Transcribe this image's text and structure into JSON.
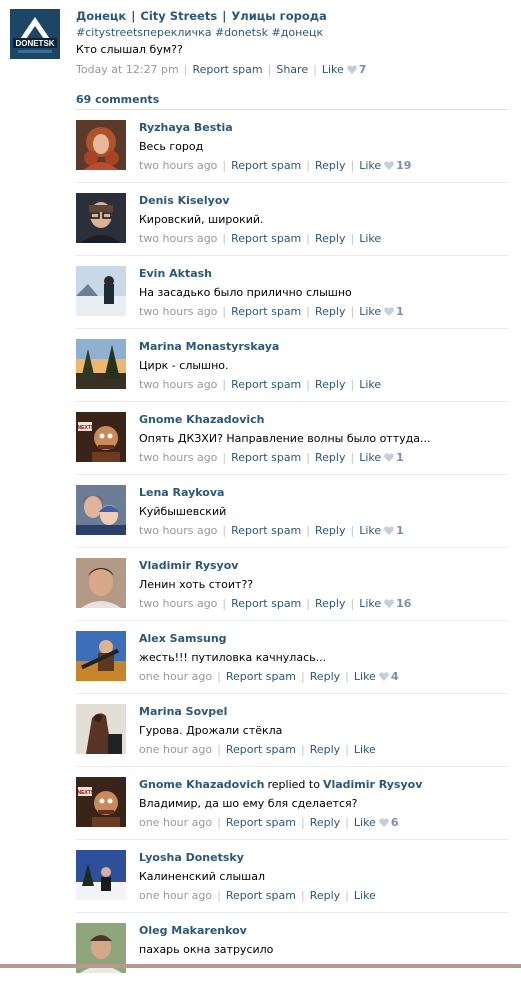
{
  "post": {
    "group_logo_text": "DONETSK",
    "header_parts": [
      "Донецк",
      "City Streets",
      "Улицы города"
    ],
    "tags": "#citystreetsперекличка #donetsk #донецк",
    "text": "Кто слышал бум??",
    "time": "Today at 12:27 pm",
    "report_label": "Report spam",
    "share_label": "Share",
    "like_label": "Like",
    "like_count": "7"
  },
  "comments_header": "69 comments",
  "comments": [
    {
      "author": "Ryzhaya Bestia",
      "reply_to": "",
      "text": "Весь город",
      "time": "two hours ago",
      "likes": "19",
      "avatar": "woman-red-hair"
    },
    {
      "author": "Denis Kiselyov",
      "reply_to": "",
      "text": "Кировский, широкий.",
      "time": "two hours ago",
      "likes": "",
      "avatar": "man-glasses"
    },
    {
      "author": "Evin Aktash",
      "reply_to": "",
      "text": "На засадько было прилично слышно",
      "time": "two hours ago",
      "likes": "1",
      "avatar": "winter-scene"
    },
    {
      "author": "Marina Monastyrskaya",
      "reply_to": "",
      "text": "Цирк - слышно.",
      "time": "two hours ago",
      "likes": "",
      "avatar": "sunset-trees"
    },
    {
      "author": "Gnome Khazadovich",
      "reply_to": "",
      "text": "Опять ДКЗХИ? Направление волны было оттуда...",
      "time": "two hours ago",
      "likes": "1",
      "avatar": "cartoon-next"
    },
    {
      "author": "Lena Raykova",
      "reply_to": "",
      "text": "Куйбышевский",
      "time": "two hours ago",
      "likes": "1",
      "avatar": "mother-child"
    },
    {
      "author": "Vladimir Rysyov",
      "reply_to": "",
      "text": "Ленин хоть стоит??",
      "time": "two hours ago",
      "likes": "16",
      "avatar": "man-portrait"
    },
    {
      "author": "Alex Samsung",
      "reply_to": "",
      "text": "жесть!!! путиловка качнулась...",
      "time": "one hour ago",
      "likes": "4",
      "avatar": "game-character"
    },
    {
      "author": "Marina Sovpel",
      "reply_to": "",
      "text": "Гурова. Дрожали стёкла",
      "time": "one hour ago",
      "likes": "",
      "avatar": "horse-photo"
    },
    {
      "author": "Gnome Khazadovich",
      "replied_label": "replied to",
      "reply_to": "Vladimir Rysyov",
      "text": "Владимир, да шо ему бля сделается?",
      "time": "one hour ago",
      "likes": "6",
      "avatar": "cartoon-next"
    },
    {
      "author": "Lyosha Donetsky",
      "reply_to": "",
      "text": "Калиненский слышал",
      "time": "one hour ago",
      "likes": "",
      "avatar": "winter-trees"
    },
    {
      "author": "Oleg Makarenkov",
      "reply_to": "",
      "text": "пахарь окна затрусило",
      "time": "",
      "likes": "",
      "avatar": "man-outdoor"
    }
  ],
  "actions": {
    "report": "Report spam",
    "reply": "Reply",
    "like": "Like"
  },
  "colors": {
    "link": "#2b587a",
    "meta": "#999999",
    "like_heart": "#c3cfdd",
    "divider": "#e7eaed"
  }
}
